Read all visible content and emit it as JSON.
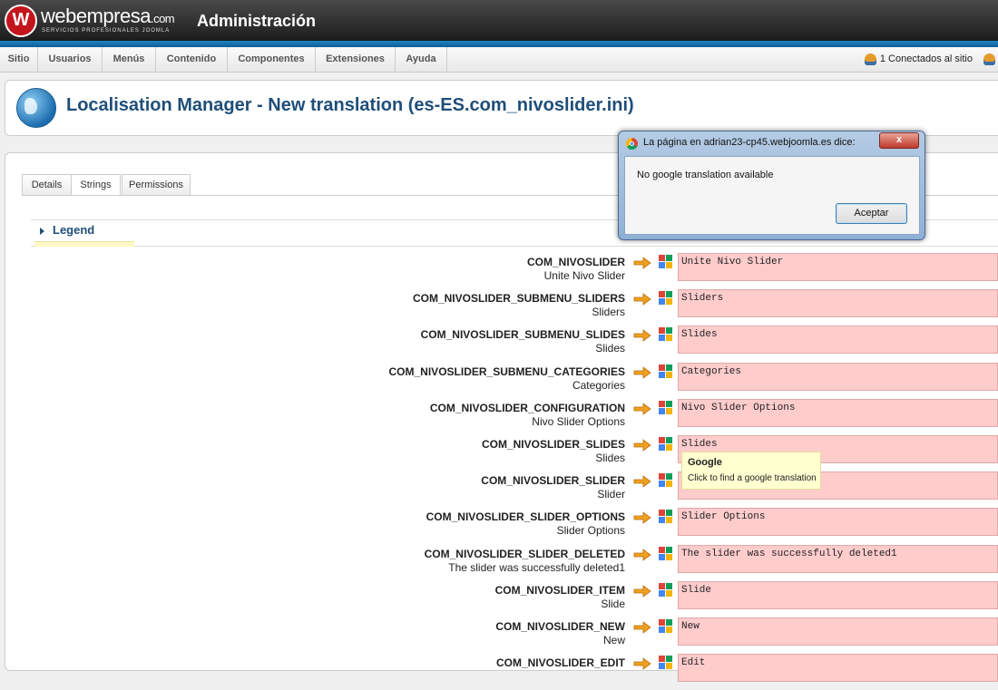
{
  "header": {
    "logo_letter": "W",
    "logo_name": "webempresa",
    "logo_tld": ".com",
    "logo_tagline": "SERVICIOS PROFESIONALES JOOMLA",
    "admin_title": "Administración"
  },
  "menu": {
    "items": [
      "Sitio",
      "Usuarios",
      "Menús",
      "Contenido",
      "Componentes",
      "Extensiones",
      "Ayuda"
    ],
    "connected": "1 Conectados al sitio"
  },
  "page": {
    "title": "Localisation Manager - New translation (es-ES.com_nivoslider.ini)"
  },
  "tabs": [
    "Details",
    "Strings",
    "Permissions"
  ],
  "legend": "Legend",
  "rows": [
    {
      "key": "COM_NIVOSLIDER",
      "original": "Unite Nivo Slider",
      "value": "Unite Nivo Slider"
    },
    {
      "key": "COM_NIVOSLIDER_SUBMENU_SLIDERS",
      "original": "Sliders",
      "value": "Sliders"
    },
    {
      "key": "COM_NIVOSLIDER_SUBMENU_SLIDES",
      "original": "Slides",
      "value": "Slides"
    },
    {
      "key": "COM_NIVOSLIDER_SUBMENU_CATEGORIES",
      "original": "Categories",
      "value": "Categories"
    },
    {
      "key": "COM_NIVOSLIDER_CONFIGURATION",
      "original": "Nivo Slider Options",
      "value": "Nivo Slider Options"
    },
    {
      "key": "COM_NIVOSLIDER_SLIDES",
      "original": "Slides",
      "value": "Slides"
    },
    {
      "key": "COM_NIVOSLIDER_SLIDER",
      "original": "Slider",
      "value": ""
    },
    {
      "key": "COM_NIVOSLIDER_SLIDER_OPTIONS",
      "original": "Slider Options",
      "value": "Slider Options"
    },
    {
      "key": "COM_NIVOSLIDER_SLIDER_DELETED",
      "original": "The slider was successfully deleted1",
      "value": "The slider was successfully deleted1"
    },
    {
      "key": "COM_NIVOSLIDER_ITEM",
      "original": "Slide",
      "value": "Slide"
    },
    {
      "key": "COM_NIVOSLIDER_NEW",
      "original": "New",
      "value": "New"
    },
    {
      "key": "COM_NIVOSLIDER_EDIT",
      "original": "",
      "value": "Edit"
    }
  ],
  "tooltip": {
    "title": "Google",
    "body": "Click to find a google translation"
  },
  "dialog": {
    "title": "La página en adrian23-cp45.webjoomla.es dice:",
    "close": "x",
    "message": "No google translation available",
    "button": "Aceptar"
  },
  "colors": {
    "header_bg": "#1c1c1c",
    "stripe": "#1e85c4",
    "field_bg": "#ffcccc",
    "title_text": "#1f4e79",
    "arrow": "#f0a020"
  }
}
